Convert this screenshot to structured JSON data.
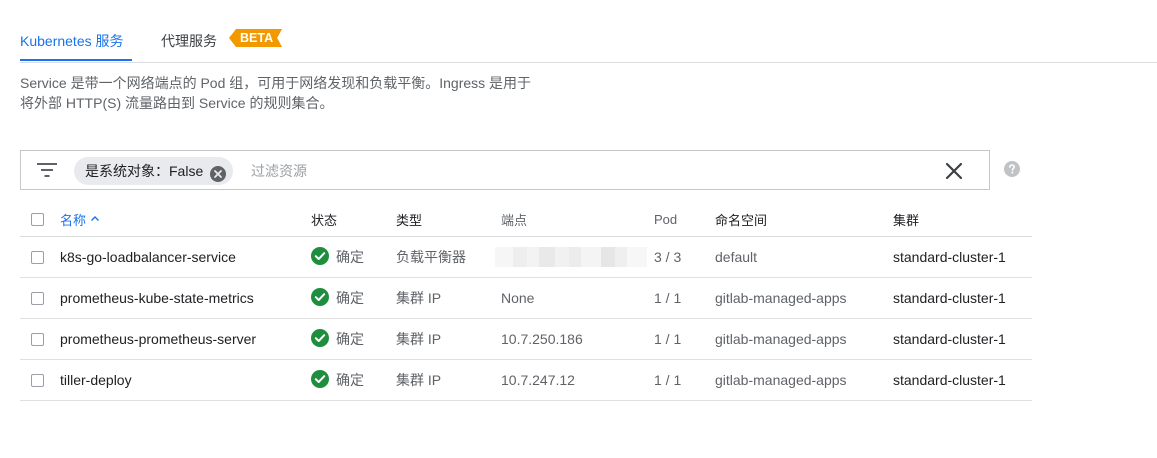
{
  "tabs": {
    "kubernetes": "Kubernetes 服务",
    "proxy": "代理服务",
    "beta_badge": "BETA"
  },
  "description": {
    "line1": "Service 是带一个网络端点的 Pod 组，可用于网络发现和负载平衡。Ingress 是用于",
    "line2": "将外部 HTTP(S) 流量路由到 Service 的规则集合。"
  },
  "filter": {
    "chip_label": "是系统对象：False",
    "placeholder": "过滤资源"
  },
  "icons": {
    "filter": "filter-icon",
    "chip_close": "cancel-icon",
    "clear": "close-icon",
    "help": "help-icon",
    "sort": "arrow-up-icon",
    "status_ok": "check-circle-icon"
  },
  "colors": {
    "accent": "#1a73e8",
    "beta": "#f29900",
    "ok": "#1e8e3e"
  },
  "table": {
    "columns": {
      "name": "名称",
      "status": "状态",
      "type": "类型",
      "endpoints": "端点",
      "pods": "Pod",
      "namespace": "命名空间",
      "cluster": "集群"
    },
    "rows": [
      {
        "name": "k8s-go-loadbalancer-service",
        "status": "确定",
        "type": "负载平衡器",
        "endpoints": "",
        "pods": "3 / 3",
        "namespace": "default",
        "cluster": "standard-cluster-1"
      },
      {
        "name": "prometheus-kube-state-metrics",
        "status": "确定",
        "type": "集群 IP",
        "endpoints": "None",
        "pods": "1 / 1",
        "namespace": "gitlab-managed-apps",
        "cluster": "standard-cluster-1"
      },
      {
        "name": "prometheus-prometheus-server",
        "status": "确定",
        "type": "集群 IP",
        "endpoints": "10.7.250.186",
        "pods": "1 / 1",
        "namespace": "gitlab-managed-apps",
        "cluster": "standard-cluster-1"
      },
      {
        "name": "tiller-deploy",
        "status": "确定",
        "type": "集群 IP",
        "endpoints": "10.7.247.12",
        "pods": "1 / 1",
        "namespace": "gitlab-managed-apps",
        "cluster": "standard-cluster-1"
      }
    ]
  }
}
